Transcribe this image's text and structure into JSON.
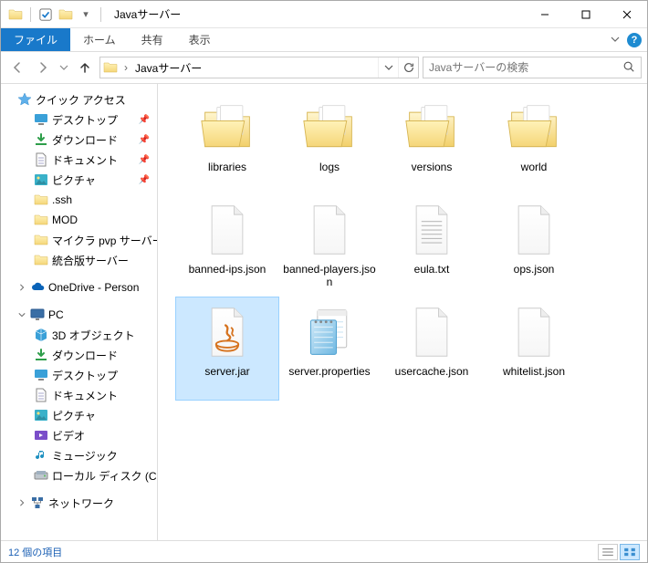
{
  "title_bar": {
    "title": "Javaサーバー"
  },
  "ribbon": {
    "file": "ファイル",
    "tabs": [
      "ホーム",
      "共有",
      "表示"
    ]
  },
  "nav": {
    "breadcrumb_segments": [
      "Javaサーバー"
    ],
    "search_placeholder": "Javaサーバーの検索"
  },
  "sidebar": {
    "quick_access": {
      "label": "クイック アクセス",
      "items": [
        {
          "label": "デスクトップ",
          "icon": "desktop",
          "pinned": true
        },
        {
          "label": "ダウンロード",
          "icon": "downloads",
          "pinned": true
        },
        {
          "label": "ドキュメント",
          "icon": "documents",
          "pinned": true
        },
        {
          "label": "ピクチャ",
          "icon": "pictures",
          "pinned": true
        },
        {
          "label": ".ssh",
          "icon": "folder",
          "pinned": false
        },
        {
          "label": "MOD",
          "icon": "folder",
          "pinned": false
        },
        {
          "label": "マイクラ pvp サーバー",
          "icon": "folder",
          "pinned": false
        },
        {
          "label": "統合版サーバー",
          "icon": "folder",
          "pinned": false
        }
      ]
    },
    "onedrive": {
      "label": "OneDrive - Person"
    },
    "pc": {
      "label": "PC",
      "items": [
        {
          "label": "3D オブジェクト",
          "icon": "3d"
        },
        {
          "label": "ダウンロード",
          "icon": "downloads"
        },
        {
          "label": "デスクトップ",
          "icon": "desktop"
        },
        {
          "label": "ドキュメント",
          "icon": "documents"
        },
        {
          "label": "ピクチャ",
          "icon": "pictures"
        },
        {
          "label": "ビデオ",
          "icon": "videos"
        },
        {
          "label": "ミュージック",
          "icon": "music"
        },
        {
          "label": "ローカル ディスク (C",
          "icon": "drive"
        }
      ]
    },
    "network": {
      "label": "ネットワーク"
    }
  },
  "content": {
    "items": [
      {
        "label": "libraries",
        "type": "folder-open"
      },
      {
        "label": "logs",
        "type": "folder-open"
      },
      {
        "label": "versions",
        "type": "folder-open"
      },
      {
        "label": "world",
        "type": "folder-open"
      },
      {
        "label": "banned-ips.json",
        "type": "file"
      },
      {
        "label": "banned-players.json",
        "type": "file"
      },
      {
        "label": "eula.txt",
        "type": "text"
      },
      {
        "label": "ops.json",
        "type": "file"
      },
      {
        "label": "server.jar",
        "type": "jar",
        "selected": true
      },
      {
        "label": "server.properties",
        "type": "notepad"
      },
      {
        "label": "usercache.json",
        "type": "file"
      },
      {
        "label": "whitelist.json",
        "type": "file"
      }
    ]
  },
  "status": {
    "text": "12 個の項目"
  },
  "colors": {
    "accent": "#1979ca",
    "selection": "#cce8ff"
  }
}
